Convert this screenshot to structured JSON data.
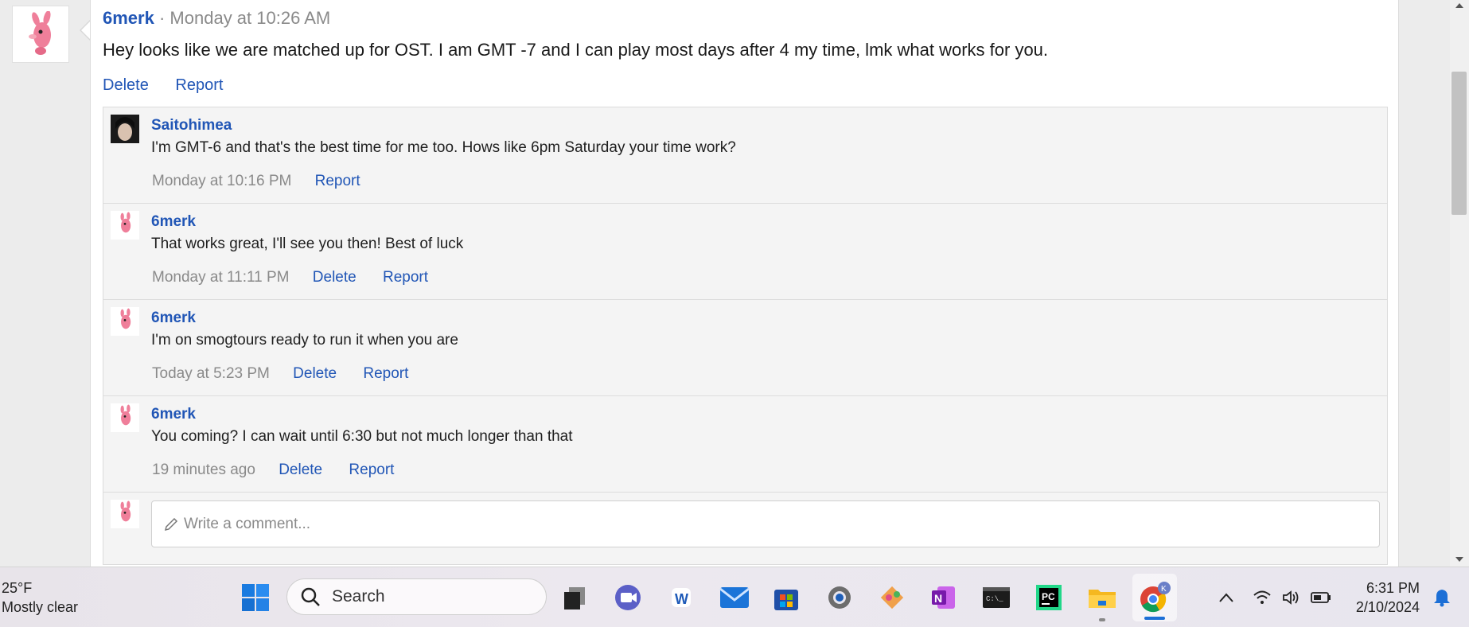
{
  "post": {
    "author": "6merk",
    "separator": "·",
    "timestamp": "Monday at 10:26 AM",
    "body": "Hey looks like we are matched up for OST. I am GMT -7 and I can play most days after 4 my time, lmk what works for you.",
    "actions": [
      "Delete",
      "Report"
    ]
  },
  "comments": [
    {
      "author": "Saitohimea",
      "text": "I'm GMT-6 and that's the best time for me too. Hows like 6pm Saturday your time work?",
      "time": "Monday at 10:16 PM",
      "actions": [
        "Report"
      ]
    },
    {
      "author": "6merk",
      "text": "That works great, I'll see you then! Best of luck",
      "time": "Monday at 11:11 PM",
      "actions": [
        "Delete",
        "Report"
      ]
    },
    {
      "author": "6merk",
      "text": "I'm on smogtours ready to run it when you are",
      "time": "Today at 5:23 PM",
      "actions": [
        "Delete",
        "Report"
      ]
    },
    {
      "author": "6merk",
      "text": "You coming? I can wait until 6:30 but not much longer than that",
      "time": "19 minutes ago",
      "actions": [
        "Delete",
        "Report"
      ]
    }
  ],
  "comment_box": {
    "placeholder": "Write a comment..."
  },
  "taskbar": {
    "weather_temp": "25°F",
    "weather_desc": "Mostly clear",
    "search_label": "Search",
    "chrome_profile_initial": "K",
    "time": "6:31 PM",
    "date": "2/10/2024",
    "app_icons": [
      "windows-start-icon",
      "task-view-icon",
      "teams-icon",
      "word-icon",
      "mail-icon",
      "store-icon",
      "settings-icon",
      "git-icon",
      "onenote-icon",
      "terminal-icon",
      "pycharm-icon",
      "file-explorer-icon",
      "chrome-icon"
    ]
  },
  "colors": {
    "link": "#2156b6",
    "meta": "#8a8a8a",
    "accent": "#1c6fd6"
  }
}
